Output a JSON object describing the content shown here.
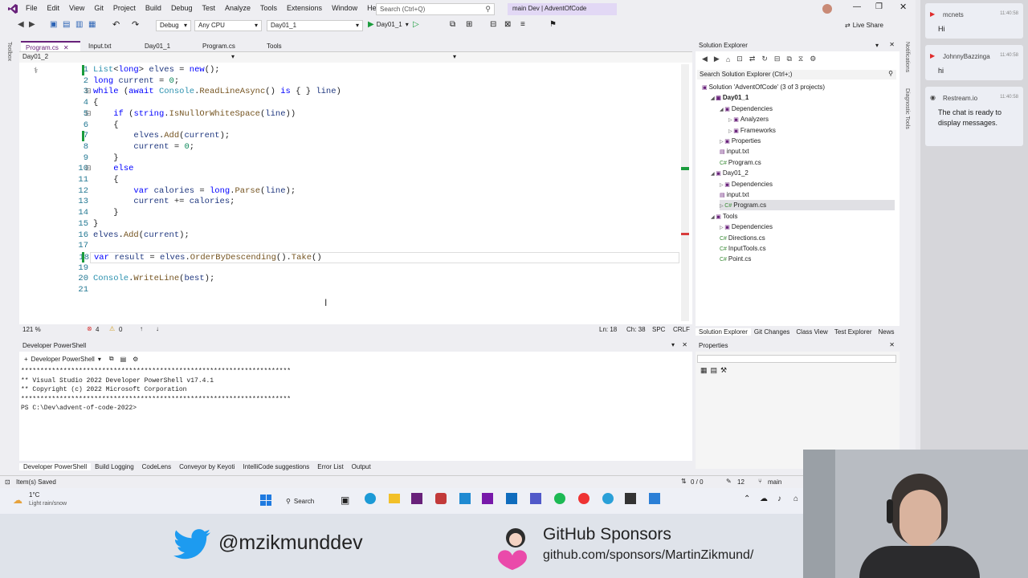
{
  "app": {
    "menu": [
      "File",
      "Edit",
      "View",
      "Git",
      "Project",
      "Build",
      "Debug",
      "Test",
      "Analyze",
      "Tools",
      "Extensions",
      "Window",
      "Help"
    ],
    "search_placeholder": "Search (Ctrl+Q)",
    "solution_title": "main Dev | AdventOfCode",
    "config": "Debug",
    "platform": "Any CPU",
    "startup_project": "Day01_1",
    "run_label": "Day01_1",
    "live_share": "Live Share"
  },
  "tabs": [
    {
      "label": "Program.cs",
      "active": true
    },
    {
      "label": "Input.txt",
      "active": false
    },
    {
      "label": "Day01_1",
      "active": false
    },
    {
      "label": "Program.cs",
      "active": false
    },
    {
      "label": "Tools",
      "active": false
    }
  ],
  "editor": {
    "nav_project": "Day01_2",
    "lines": [
      {
        "n": "1"
      },
      {
        "n": "2"
      },
      {
        "n": "3"
      },
      {
        "n": "4"
      },
      {
        "n": "5"
      },
      {
        "n": "6"
      },
      {
        "n": "7"
      },
      {
        "n": "8"
      },
      {
        "n": "9"
      },
      {
        "n": "10"
      },
      {
        "n": "11"
      },
      {
        "n": "12"
      },
      {
        "n": "13"
      },
      {
        "n": "14"
      },
      {
        "n": "15"
      },
      {
        "n": "16"
      },
      {
        "n": "17"
      },
      {
        "n": "18"
      },
      {
        "n": "19"
      },
      {
        "n": "20"
      },
      {
        "n": "21"
      }
    ],
    "status": {
      "zoom": "121 %",
      "errors": "4",
      "warnings": "0",
      "position": "Ln: 18",
      "column": "Ch: 38",
      "spacing": "SPC",
      "line_ending": "CRLF"
    }
  },
  "terminal": {
    "title": "Developer PowerShell",
    "dropdown": "Developer PowerShell",
    "lines": [
      "**********************************************************************",
      "** Visual Studio 2022 Developer PowerShell v17.4.1",
      "** Copyright (c) 2022 Microsoft Corporation",
      "**********************************************************************",
      "PS C:\\Dev\\advent-of-code-2022>"
    ]
  },
  "bottom_tabs": [
    "Developer PowerShell",
    "Build Logging",
    "CodeLens",
    "Conveyor by Keyoti",
    "IntelliCode suggestions",
    "Error List",
    "Output"
  ],
  "statusbar": {
    "left": "Item(s) Saved",
    "counts": "0 / 0",
    "changes": "12",
    "branch": "main"
  },
  "solution_explorer": {
    "title": "Solution Explorer",
    "search": "Search Solution Explorer (Ctrl+;)",
    "tree": [
      {
        "label": "Solution 'AdventOfCode' (3 of 3 projects)",
        "depth": 0
      },
      {
        "label": "Day01_1",
        "depth": 1,
        "bold": true
      },
      {
        "label": "Dependencies",
        "depth": 2
      },
      {
        "label": "Analyzers",
        "depth": 3
      },
      {
        "label": "Frameworks",
        "depth": 3
      },
      {
        "label": "Properties",
        "depth": 2
      },
      {
        "label": "input.txt",
        "depth": 2
      },
      {
        "label": "Program.cs",
        "depth": 2
      },
      {
        "label": "Day01_2",
        "depth": 1
      },
      {
        "label": "Dependencies",
        "depth": 2
      },
      {
        "label": "input.txt",
        "depth": 2
      },
      {
        "label": "Program.cs",
        "depth": 2,
        "selected": true
      },
      {
        "label": "Tools",
        "depth": 1
      },
      {
        "label": "Dependencies",
        "depth": 2
      },
      {
        "label": "Directions.cs",
        "depth": 2
      },
      {
        "label": "InputTools.cs",
        "depth": 2
      },
      {
        "label": "Point.cs",
        "depth": 2
      }
    ],
    "tabs": [
      "Solution Explorer",
      "Git Changes",
      "Class View",
      "Test Explorer",
      "News"
    ]
  },
  "properties": {
    "title": "Properties"
  },
  "chat": [
    {
      "name": "mcnets",
      "time": "11:40:58",
      "text": "Hi"
    },
    {
      "name": "JohnnyBazzinga",
      "time": "11:40:58",
      "text": "hi"
    },
    {
      "name": "Restream.io",
      "time": "11:40:58",
      "text": "The chat is ready to display messages."
    }
  ],
  "taskbar": {
    "weather_temp": "1°C",
    "weather_desc": "Light rain/snow",
    "search": "Search"
  },
  "overlay": {
    "twitter": "@mzikmunddev",
    "sponsors_title": "GitHub Sponsors",
    "sponsors_url": "github.com/sponsors/MartinZikmund/"
  },
  "colors": {
    "keyword": "#0000ff",
    "type": "#2b91af",
    "accent": "#68217a",
    "twitter": "#1d9bf0"
  }
}
